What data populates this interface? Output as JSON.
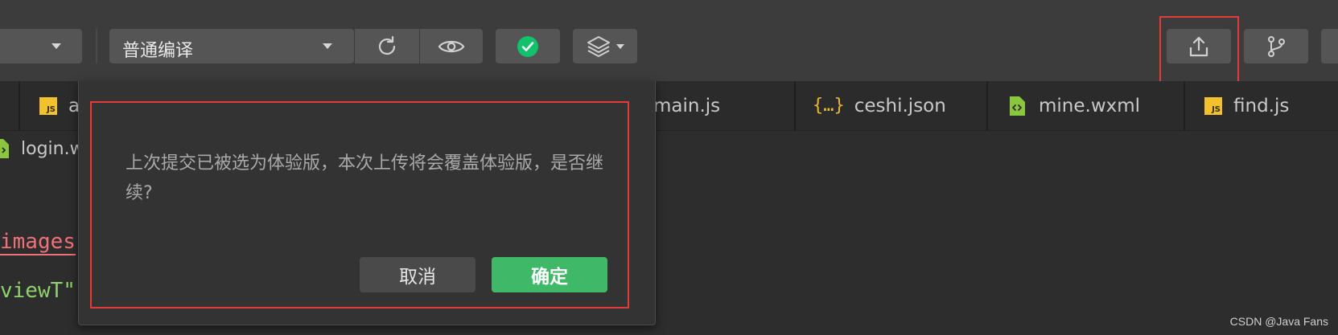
{
  "toolbar": {
    "compile_mode": "普通编译",
    "icons": {
      "dropdown_caret": "chevron-down-icon",
      "refresh": "refresh-icon",
      "preview": "eye-icon",
      "real_device_debug": "check-circle-icon",
      "layers": "layers-icon",
      "upload": "upload-icon",
      "version_management": "branch-icon"
    },
    "accent_green": "#3fb968",
    "highlight_color": "#e33b3b"
  },
  "tabs": [
    {
      "label": "a",
      "type": "js"
    },
    {
      "label": "main.js",
      "type": "js"
    },
    {
      "label": "ceshi.json",
      "type": "json"
    },
    {
      "label": "mine.wxml",
      "type": "wxml"
    },
    {
      "label": "find.js",
      "type": "js"
    }
  ],
  "breadcrumb": {
    "file": "login.w"
  },
  "code": {
    "line1": "images",
    "line2": "viewT\""
  },
  "dialog": {
    "message": "上次提交已被选为体验版，本次上传将会覆盖体验版，是否继续?",
    "cancel_label": "取消",
    "confirm_label": "确定"
  },
  "watermark": "CSDN @Java Fans"
}
